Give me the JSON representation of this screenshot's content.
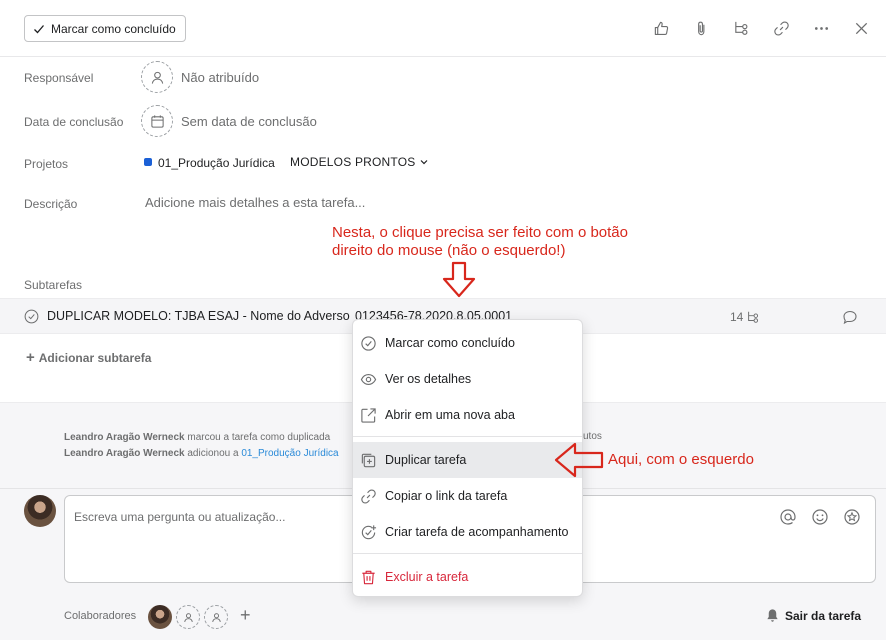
{
  "header": {
    "complete_label": "Marcar como concluído",
    "icons": [
      "like-icon",
      "attachment-icon",
      "subtask-icon",
      "link-icon",
      "more-icon",
      "close-icon"
    ]
  },
  "fields": {
    "assignee_label": "Responsável",
    "assignee_value": "Não atribuído",
    "due_label": "Data de conclusão",
    "due_value": "Sem data de conclusão",
    "projects_label": "Projetos",
    "project_name": "01_Produção Jurídica",
    "project_section": "MODELOS PRONTOS",
    "project_color": "#1b60d6",
    "description_label": "Descrição",
    "description_placeholder": "Adicione mais detalhes a esta tarefa..."
  },
  "annotations": {
    "top_line1": "Nesta, o clique precisa ser feito com o botão",
    "top_line2": "direito do mouse (não o esquerdo!)",
    "right": "Aqui, com o esquerdo",
    "color": "#d8271c"
  },
  "subtasks": {
    "label": "Subtarefas",
    "row_name": "DUPLICAR MODELO: TJBA ESAJ - Nome do Adverso -",
    "row_name_tail": "0123456-78.2020.8.05.0001",
    "row_count": "14",
    "add_label": "Adicionar subtarefa"
  },
  "activity": {
    "line1_user": "Leandro Aragão Werneck",
    "line1_text": "marcou a tarefa como duplicada",
    "line1_right": "utos",
    "line2_user": "Leandro Aragão Werneck",
    "line2_text": "adicionou a",
    "line2_link": "01_Produção Jurídica"
  },
  "comment": {
    "placeholder": "Escreva uma pergunta ou atualização...",
    "icons": [
      "mention-icon",
      "emoji-icon",
      "star-icon"
    ]
  },
  "collaborators": {
    "label": "Colaboradores",
    "add": "+",
    "leave_label": "Sair da tarefa"
  },
  "context_menu": {
    "items": [
      {
        "label": "Marcar como concluído",
        "icon": "check-circle-icon"
      },
      {
        "label": "Ver os detalhes",
        "icon": "eye-icon"
      },
      {
        "label": "Abrir em uma nova aba",
        "icon": "open-external-icon"
      },
      {
        "label": "Duplicar tarefa",
        "icon": "duplicate-icon",
        "highlighted": true
      },
      {
        "label": "Copiar o link da tarefa",
        "icon": "link-icon"
      },
      {
        "label": "Criar tarefa de acompanhamento",
        "icon": "follow-up-icon"
      },
      {
        "label": "Excluir a tarefa",
        "icon": "trash-icon",
        "danger": true
      }
    ]
  }
}
